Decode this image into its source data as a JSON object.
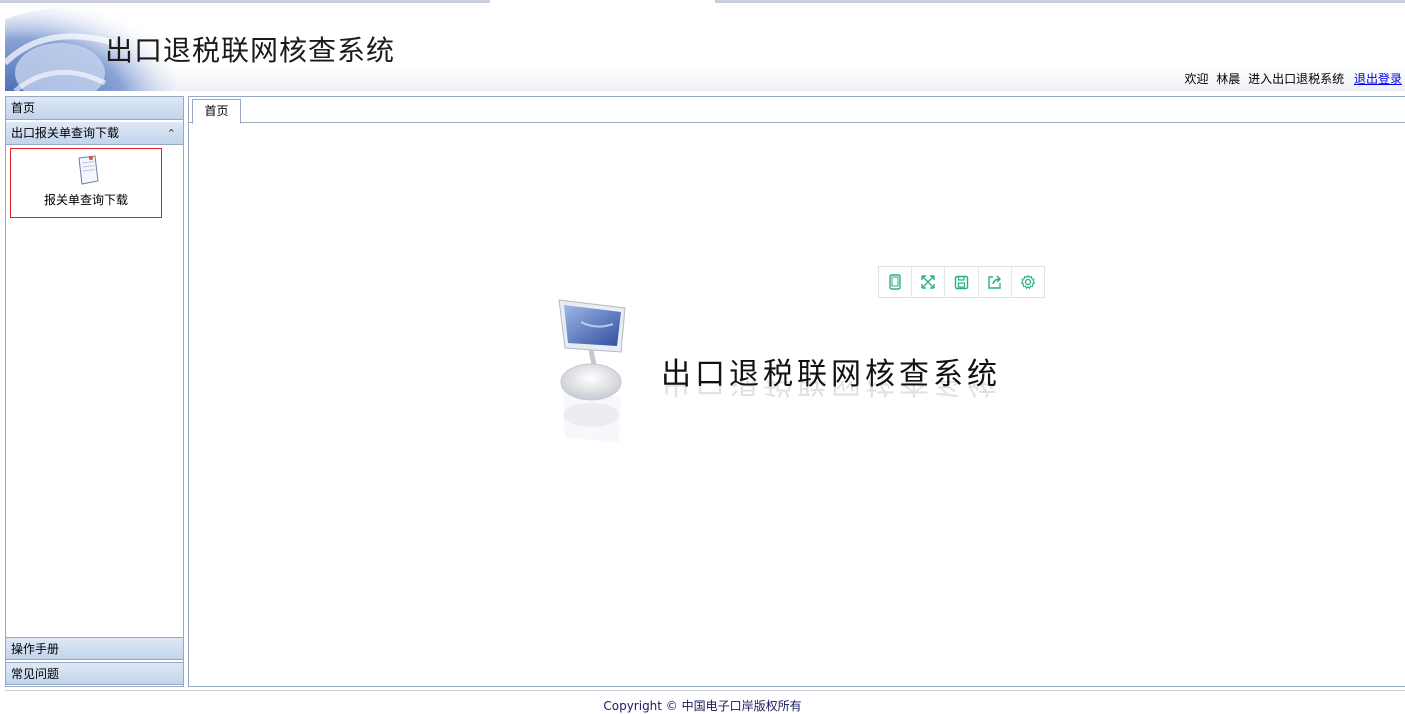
{
  "header": {
    "system_title": "出口退税联网核查系统",
    "welcome_prefix": "欢迎",
    "user_name": "林晨",
    "welcome_suffix": "进入出口退税系统",
    "logout_label": "退出登录"
  },
  "sidebar": {
    "sections": [
      {
        "label": "首页"
      },
      {
        "label": "出口报关单查询下载",
        "expanded": true
      },
      {
        "label": "操作手册"
      },
      {
        "label": "常见问题"
      }
    ],
    "items": [
      {
        "label": "报关单查询下载",
        "icon": "document-icon"
      }
    ]
  },
  "tabs": [
    {
      "label": "首页",
      "active": true
    }
  ],
  "toolbar": {
    "buttons": [
      "tablet-icon",
      "fullscreen-icon",
      "save-icon",
      "share-icon",
      "settings-icon"
    ],
    "accent_color": "#2bb07a"
  },
  "center": {
    "title": "出口退税联网核查系统"
  },
  "footer": {
    "copyright": "Copyright © 中国电子口岸版权所有"
  }
}
